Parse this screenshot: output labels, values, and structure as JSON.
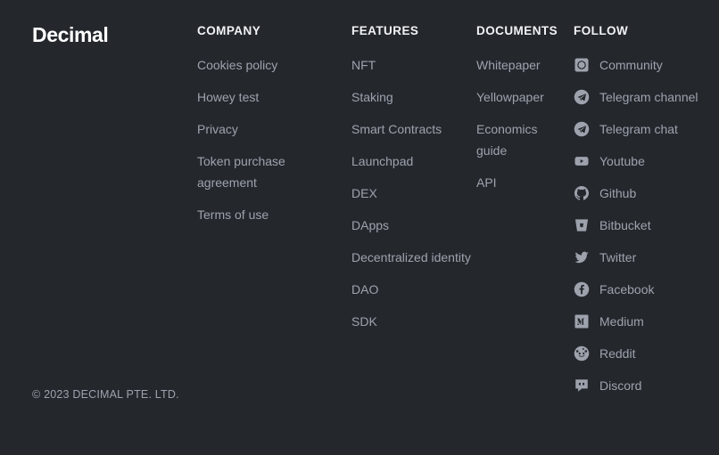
{
  "theme": {
    "background": "#24282d",
    "heading_color": "#f2f3f5",
    "link_color": "#9da2ad",
    "logo_color": "#ffffff"
  },
  "brand": {
    "logo_text": "Decimal"
  },
  "columns": {
    "company": {
      "heading": "COMPANY",
      "links": [
        "Cookies policy",
        "Howey test",
        "Privacy",
        "Token purchase agreement",
        "Terms of use"
      ]
    },
    "features": {
      "heading": "FEATURES",
      "links": [
        "NFT",
        "Staking",
        "Smart Contracts",
        "Launchpad",
        "DEX",
        "DApps",
        "Decentralized identity",
        "DAO",
        "SDK"
      ]
    },
    "documents": {
      "heading": "DOCUMENTS",
      "links": [
        "Whitepaper",
        "Yellowpaper",
        "Economics guide",
        "API"
      ]
    },
    "follow": {
      "heading": "FOLLOW",
      "links": [
        {
          "label": "Community",
          "icon": "community-icon"
        },
        {
          "label": "Telegram channel",
          "icon": "telegram-icon"
        },
        {
          "label": "Telegram chat",
          "icon": "telegram-icon"
        },
        {
          "label": "Youtube",
          "icon": "youtube-icon"
        },
        {
          "label": "Github",
          "icon": "github-icon"
        },
        {
          "label": "Bitbucket",
          "icon": "bitbucket-icon"
        },
        {
          "label": "Twitter",
          "icon": "twitter-icon"
        },
        {
          "label": "Facebook",
          "icon": "facebook-icon"
        },
        {
          "label": "Medium",
          "icon": "medium-icon"
        },
        {
          "label": "Reddit",
          "icon": "reddit-icon"
        },
        {
          "label": "Discord",
          "icon": "discord-icon"
        }
      ]
    }
  },
  "copyright": "© 2023 DECIMAL PTE. LTD."
}
